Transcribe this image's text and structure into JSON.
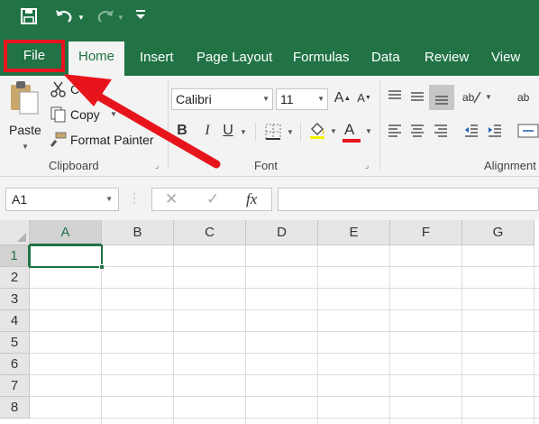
{
  "qat": {
    "save_icon": "save-icon",
    "undo_icon": "undo-icon",
    "redo_icon": "redo-icon",
    "customize_icon": "customize-qat-icon"
  },
  "tabs": {
    "file": "File",
    "home": "Home",
    "insert": "Insert",
    "page_layout": "Page Layout",
    "formulas": "Formulas",
    "data": "Data",
    "review": "Review",
    "view": "View"
  },
  "clipboard": {
    "paste": "Paste",
    "cut": "C",
    "copy": "Copy",
    "format_painter": "Format Painter",
    "group_label": "Clipboard"
  },
  "font": {
    "name": "Calibri",
    "size": "11",
    "bold": "B",
    "italic": "I",
    "underline": "U",
    "font_color": "A",
    "grow": "A",
    "shrink": "A",
    "group_label": "Font",
    "font_color_swatch": "#e8141c"
  },
  "alignment": {
    "group_label": "Alignment"
  },
  "formula_bar": {
    "name_box": "A1",
    "cancel": "✕",
    "enter": "✓",
    "fx": "fx",
    "formula": ""
  },
  "grid": {
    "columns": [
      "A",
      "B",
      "C",
      "D",
      "E",
      "F",
      "G"
    ],
    "rows": [
      "1",
      "2",
      "3",
      "4",
      "5",
      "6",
      "7",
      "8"
    ],
    "active_cell": "A1"
  },
  "colors": {
    "brand_green": "#217346",
    "highlight_red": "#e8141c"
  }
}
